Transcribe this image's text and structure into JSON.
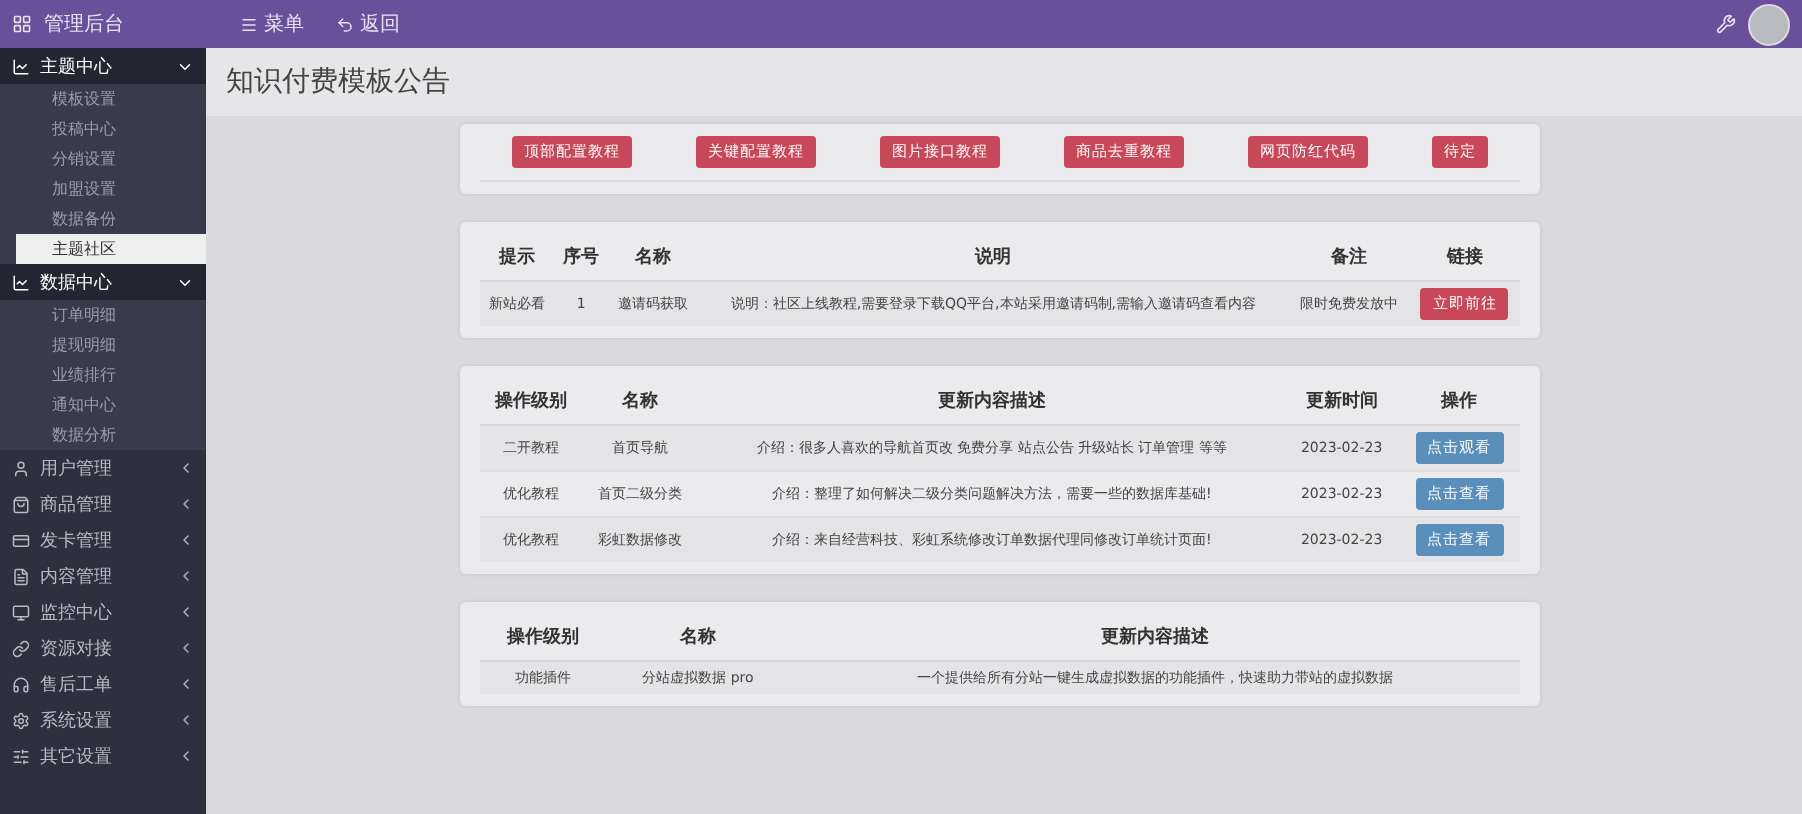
{
  "topbar": {
    "title": "管理后台",
    "menu": "菜单",
    "back": "返回"
  },
  "sidebar": [
    {
      "label": "主题中心",
      "expanded": true,
      "children": [
        {
          "label": "模板设置",
          "selected": false
        },
        {
          "label": "投稿中心",
          "selected": false
        },
        {
          "label": "分销设置",
          "selected": false
        },
        {
          "label": "加盟设置",
          "selected": false
        },
        {
          "label": "数据备份",
          "selected": false
        },
        {
          "label": "主题社区",
          "selected": true
        }
      ]
    },
    {
      "label": "数据中心",
      "expanded": true,
      "children": [
        {
          "label": "订单明细",
          "selected": false
        },
        {
          "label": "提现明细",
          "selected": false
        },
        {
          "label": "业绩排行",
          "selected": false
        },
        {
          "label": "通知中心",
          "selected": false
        },
        {
          "label": "数据分析",
          "selected": false
        }
      ]
    },
    {
      "label": "用户管理",
      "expanded": false
    },
    {
      "label": "商品管理",
      "expanded": false
    },
    {
      "label": "发卡管理",
      "expanded": false
    },
    {
      "label": "内容管理",
      "expanded": false
    },
    {
      "label": "监控中心",
      "expanded": false
    },
    {
      "label": "资源对接",
      "expanded": false
    },
    {
      "label": "售后工单",
      "expanded": false
    },
    {
      "label": "系统设置",
      "expanded": false
    },
    {
      "label": "其它设置",
      "expanded": false
    }
  ],
  "page_title": "知识付费模板公告",
  "tutorial_buttons": [
    "顶部配置教程",
    "关键配置教程",
    "图片接口教程",
    "商品去重教程",
    "网页防红代码",
    "待定"
  ],
  "notice_table": {
    "columns": [
      "提示",
      "序号",
      "名称",
      "说明",
      "备注",
      "链接"
    ],
    "rows": [
      {
        "cells": [
          "新站必看",
          "1",
          "邀请码获取",
          "说明：社区上线教程,需要登录下载QQ平台,本站采用邀请码制,需输入邀请码查看内容",
          "限时免费发放中"
        ],
        "action": "立即前往"
      }
    ]
  },
  "update_table": {
    "columns": [
      "操作级别",
      "名称",
      "更新内容描述",
      "更新时间",
      "操作"
    ],
    "rows": [
      {
        "cells": [
          "二开教程",
          "首页导航",
          "介绍：很多人喜欢的导航首页改 免费分享 站点公告 升级站长 订单管理 等等",
          "2023-02-23"
        ],
        "action": "点击观看"
      },
      {
        "cells": [
          "优化教程",
          "首页二级分类",
          "介绍：整理了如何解决二级分类问题解决方法，需要一些的数据库基础!",
          "2023-02-23"
        ],
        "action": "点击查看"
      },
      {
        "cells": [
          "优化教程",
          "彩虹数据修改",
          "介绍：来自经营科技、彩虹系统修改订单数据代理同修改订单统计页面!",
          "2023-02-23"
        ],
        "action": "点击查看"
      }
    ]
  },
  "plugin_table": {
    "columns": [
      "操作级别",
      "名称",
      "更新内容描述"
    ],
    "rows": [
      {
        "cells": [
          "功能插件",
          "分站虚拟数据 pro",
          "一个提供给所有分站一键生成虚拟数据的功能插件，快速助力带站的虚拟数据"
        ]
      }
    ]
  }
}
